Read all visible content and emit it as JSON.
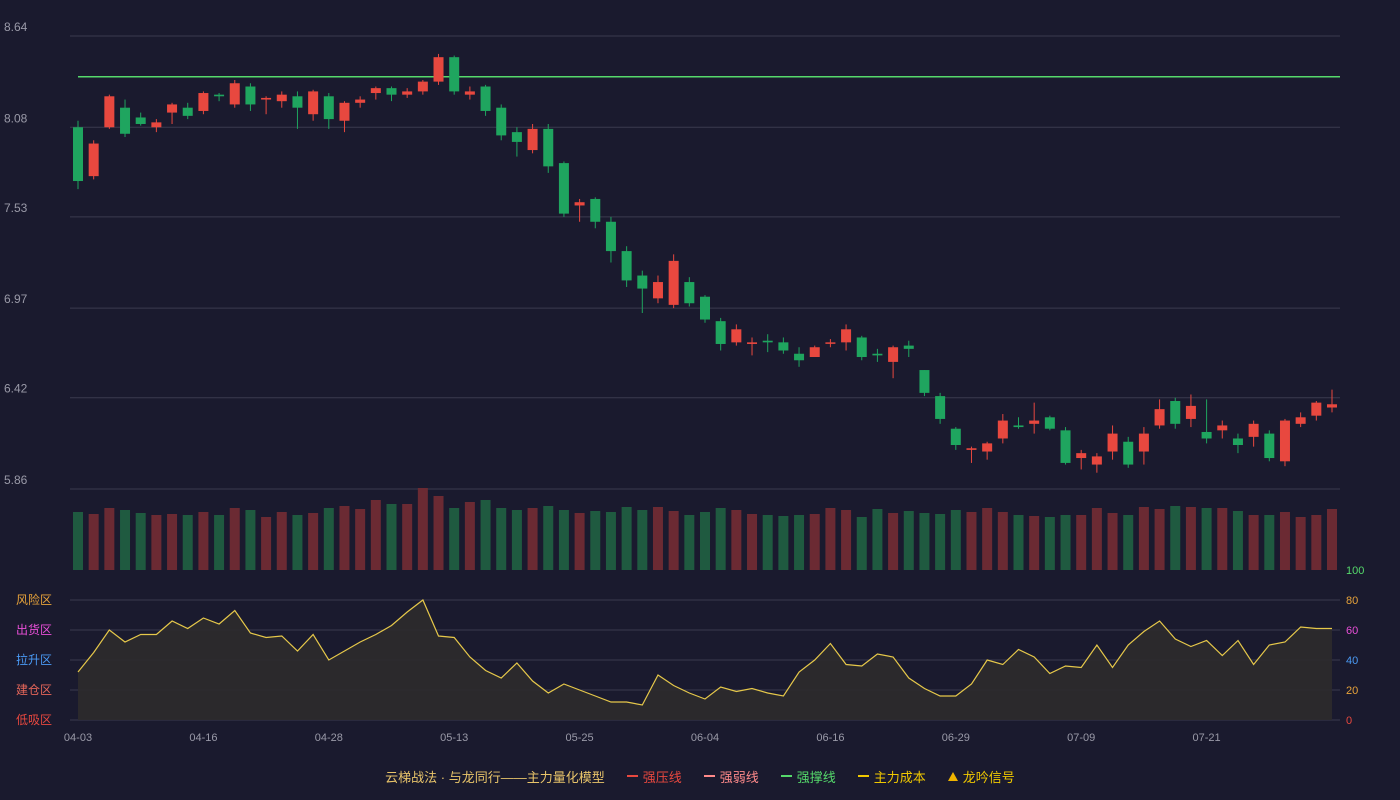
{
  "colors": {
    "background": "#1a1a2e",
    "up": "#e8483f",
    "down": "#1fa55f",
    "volume_up": "#6b2a33",
    "volume_down": "#1f5a40",
    "support_line": "#55d96b",
    "grid": "#3a3a4e",
    "axis_text": "#9a9aa8",
    "oscillator_line": "#e6c84a",
    "oscillator_fill": "#2e2b2c"
  },
  "chart_data": [
    {
      "type": "candlestick",
      "name": "price",
      "y_ticks": [
        5.86,
        6.42,
        6.97,
        7.53,
        8.08,
        8.64
      ],
      "ylim": [
        5.86,
        8.64
      ],
      "x_labels": [
        "04-03",
        "04-16",
        "04-28",
        "05-13",
        "05-25",
        "06-04",
        "06-16",
        "06-29",
        "07-09",
        "07-21"
      ],
      "x_label_indices": [
        0,
        8,
        16,
        24,
        32,
        40,
        48,
        56,
        64,
        72
      ],
      "support_line_value": 8.39,
      "candles": [
        [
          8.08,
          7.75,
          8.12,
          7.7
        ],
        [
          7.78,
          7.98,
          8.0,
          7.76
        ],
        [
          8.08,
          8.27,
          8.28,
          8.07
        ],
        [
          8.2,
          8.04,
          8.25,
          8.02
        ],
        [
          8.14,
          8.1,
          8.17,
          8.09
        ],
        [
          8.08,
          8.11,
          8.13,
          8.05
        ],
        [
          8.17,
          8.22,
          8.23,
          8.1
        ],
        [
          8.2,
          8.15,
          8.23,
          8.13
        ],
        [
          8.18,
          8.29,
          8.3,
          8.16
        ],
        [
          8.28,
          8.27,
          8.29,
          8.24
        ],
        [
          8.22,
          8.35,
          8.37,
          8.2
        ],
        [
          8.33,
          8.22,
          8.35,
          8.18
        ],
        [
          8.25,
          8.26,
          8.27,
          8.16
        ],
        [
          8.24,
          8.28,
          8.3,
          8.2
        ],
        [
          8.27,
          8.2,
          8.3,
          8.07
        ],
        [
          8.16,
          8.3,
          8.31,
          8.12
        ],
        [
          8.27,
          8.13,
          8.29,
          8.07
        ],
        [
          8.12,
          8.23,
          8.24,
          8.05
        ],
        [
          8.23,
          8.25,
          8.27,
          8.2
        ],
        [
          8.29,
          8.32,
          8.33,
          8.25
        ],
        [
          8.32,
          8.28,
          8.33,
          8.24
        ],
        [
          8.28,
          8.3,
          8.32,
          8.26
        ],
        [
          8.3,
          8.36,
          8.37,
          8.28
        ],
        [
          8.36,
          8.51,
          8.53,
          8.34
        ],
        [
          8.51,
          8.3,
          8.52,
          8.28
        ],
        [
          8.28,
          8.3,
          8.33,
          8.25
        ],
        [
          8.33,
          8.18,
          8.34,
          8.15
        ],
        [
          8.2,
          8.03,
          8.22,
          8.0
        ],
        [
          8.05,
          7.99,
          8.08,
          7.9
        ],
        [
          7.94,
          8.07,
          8.1,
          7.92
        ],
        [
          8.07,
          7.84,
          8.1,
          7.8
        ],
        [
          7.86,
          7.55,
          7.87,
          7.53
        ],
        [
          7.6,
          7.62,
          7.64,
          7.5
        ],
        [
          7.64,
          7.5,
          7.65,
          7.46
        ],
        [
          7.5,
          7.32,
          7.53,
          7.25
        ],
        [
          7.32,
          7.14,
          7.35,
          7.1
        ],
        [
          7.17,
          7.09,
          7.2,
          6.94
        ],
        [
          7.03,
          7.13,
          7.17,
          7.0
        ],
        [
          6.99,
          7.26,
          7.3,
          6.97
        ],
        [
          7.13,
          7.0,
          7.16,
          6.98
        ],
        [
          7.04,
          6.9,
          7.05,
          6.88
        ],
        [
          6.89,
          6.75,
          6.91,
          6.71
        ],
        [
          6.76,
          6.84,
          6.87,
          6.74
        ],
        [
          6.75,
          6.76,
          6.79,
          6.68
        ],
        [
          6.77,
          6.76,
          6.81,
          6.7
        ],
        [
          6.76,
          6.71,
          6.79,
          6.69
        ],
        [
          6.69,
          6.65,
          6.73,
          6.61
        ],
        [
          6.67,
          6.73,
          6.74,
          6.67
        ],
        [
          6.76,
          6.76,
          6.78,
          6.73
        ],
        [
          6.76,
          6.84,
          6.87,
          6.71
        ],
        [
          6.79,
          6.67,
          6.8,
          6.65
        ],
        [
          6.69,
          6.68,
          6.72,
          6.64
        ],
        [
          6.64,
          6.73,
          6.74,
          6.54
        ],
        [
          6.74,
          6.72,
          6.77,
          6.67
        ],
        [
          6.59,
          6.45,
          6.59,
          6.43
        ],
        [
          6.43,
          6.29,
          6.45,
          6.26
        ],
        [
          6.23,
          6.13,
          6.24,
          6.1
        ],
        [
          6.1,
          6.11,
          6.12,
          6.02
        ],
        [
          6.09,
          6.14,
          6.15,
          6.04
        ],
        [
          6.17,
          6.28,
          6.32,
          6.14
        ],
        [
          6.25,
          6.24,
          6.3,
          6.23
        ],
        [
          6.26,
          6.28,
          6.39,
          6.2
        ],
        [
          6.3,
          6.23,
          6.31,
          6.22
        ],
        [
          6.22,
          6.02,
          6.24,
          6.01
        ],
        [
          6.05,
          6.08,
          6.1,
          5.98
        ],
        [
          6.01,
          6.06,
          6.08,
          5.96
        ],
        [
          6.09,
          6.2,
          6.25,
          6.04
        ],
        [
          6.15,
          6.01,
          6.18,
          5.99
        ],
        [
          6.09,
          6.2,
          6.24,
          6.01
        ],
        [
          6.25,
          6.35,
          6.41,
          6.23
        ],
        [
          6.4,
          6.26,
          6.42,
          6.23
        ],
        [
          6.29,
          6.37,
          6.44,
          6.24
        ],
        [
          6.21,
          6.17,
          6.41,
          6.14
        ],
        [
          6.22,
          6.25,
          6.28,
          6.17
        ],
        [
          6.17,
          6.13,
          6.2,
          6.08
        ],
        [
          6.18,
          6.26,
          6.28,
          6.12
        ],
        [
          6.2,
          6.05,
          6.22,
          6.03
        ],
        [
          6.03,
          6.28,
          6.29,
          6.0
        ],
        [
          6.26,
          6.3,
          6.33,
          6.24
        ],
        [
          6.31,
          6.39,
          6.4,
          6.28
        ],
        [
          6.36,
          6.38,
          6.47,
          6.33
        ]
      ],
      "volumes": [
        58,
        56,
        62,
        60,
        57,
        55,
        56,
        55,
        58,
        55,
        62,
        60,
        53,
        58,
        55,
        57,
        62,
        64,
        61,
        70,
        66,
        66,
        82,
        74,
        62,
        68,
        70,
        62,
        60,
        62,
        64,
        60,
        57,
        59,
        58,
        63,
        60,
        63,
        59,
        55,
        58,
        62,
        60,
        56,
        55,
        54,
        55,
        56,
        62,
        60,
        53,
        61,
        57,
        59,
        57,
        56,
        60,
        58,
        62,
        58,
        55,
        54,
        53,
        55,
        55,
        62,
        57,
        55,
        63,
        61,
        64,
        63,
        62,
        62,
        59,
        55,
        55,
        58,
        53,
        55,
        61
      ]
    },
    {
      "type": "area",
      "name": "oscillator",
      "ylim": [
        0,
        100
      ],
      "y_ticks": [
        0,
        20,
        40,
        60,
        80,
        100
      ],
      "zones": [
        "风险区",
        "出货区",
        "拉升区",
        "建仓区",
        "低吸区"
      ],
      "values": [
        32,
        45,
        60,
        52,
        57,
        57,
        66,
        61,
        68,
        64,
        73,
        58,
        55,
        56,
        46,
        57,
        40,
        46,
        52,
        57,
        63,
        72,
        80,
        56,
        55,
        42,
        33,
        28,
        38,
        26,
        18,
        24,
        20,
        16,
        12,
        12,
        10,
        30,
        23,
        18,
        14,
        22,
        19,
        21,
        18,
        16,
        32,
        40,
        51,
        37,
        36,
        44,
        42,
        28,
        21,
        16,
        16,
        24,
        40,
        37,
        47,
        42,
        31,
        36,
        35,
        50,
        35,
        50,
        59,
        66,
        54,
        49,
        53,
        43,
        53,
        37,
        50,
        52,
        62,
        61,
        61
      ]
    }
  ],
  "legend": {
    "title": "云梯战法 · 与龙同行——主力量化模型",
    "items": [
      {
        "label": "强压线",
        "color": "#e8483f",
        "style": "solid"
      },
      {
        "label": "强弱线",
        "color": "#e8483f",
        "style": "dashed"
      },
      {
        "label": "强撑线",
        "color": "#55d96b",
        "style": "solid"
      },
      {
        "label": "主力成本",
        "color": "#f0c800",
        "style": "dashed"
      },
      {
        "label": "龙吟信号",
        "color": "#f0b400",
        "style": "triangle"
      }
    ]
  },
  "zone_colors": [
    "#e8a33a",
    "#e94fd8",
    "#4a9af5",
    "#e5665a",
    "#e8483f"
  ],
  "oscillator_tick_colors": [
    "#e8483f",
    "#e8a33a",
    "#4a9af5",
    "#e94fd8",
    "#e8a33a",
    "#55d96b"
  ]
}
